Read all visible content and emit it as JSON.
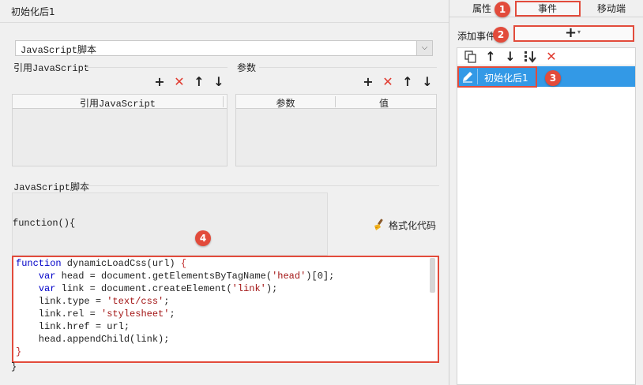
{
  "window_title": "初始化后1",
  "script_type": {
    "selected": "JavaScript脚本"
  },
  "ref_js": {
    "title": "引用JavaScript",
    "column": "引用JavaScript"
  },
  "params": {
    "title": "参数",
    "columns": [
      "参数",
      "值"
    ]
  },
  "js_section": {
    "title": "JavaScript脚本",
    "function_header": "function(){",
    "format_label": "格式化代码",
    "closing": "}"
  },
  "code_lines": [
    "function dynamicLoadCss(url) {",
    "    var head = document.getElementsByTagName('head')[0];",
    "    var link = document.createElement('link');",
    "    link.type = 'text/css';",
    "    link.rel = 'stylesheet';",
    "    link.href = url;",
    "    head.appendChild(link);",
    "}"
  ],
  "right_tabs": [
    "属性",
    "事件",
    "移动端"
  ],
  "add_event": {
    "label": "添加事件",
    "button": "+"
  },
  "event_items": [
    {
      "label": "初始化后1"
    }
  ],
  "callouts": [
    "1",
    "2",
    "3",
    "4"
  ],
  "colors": {
    "accent": "#3399e6",
    "callout": "#e24b3b",
    "toolbar_red": "#e03a2f"
  }
}
